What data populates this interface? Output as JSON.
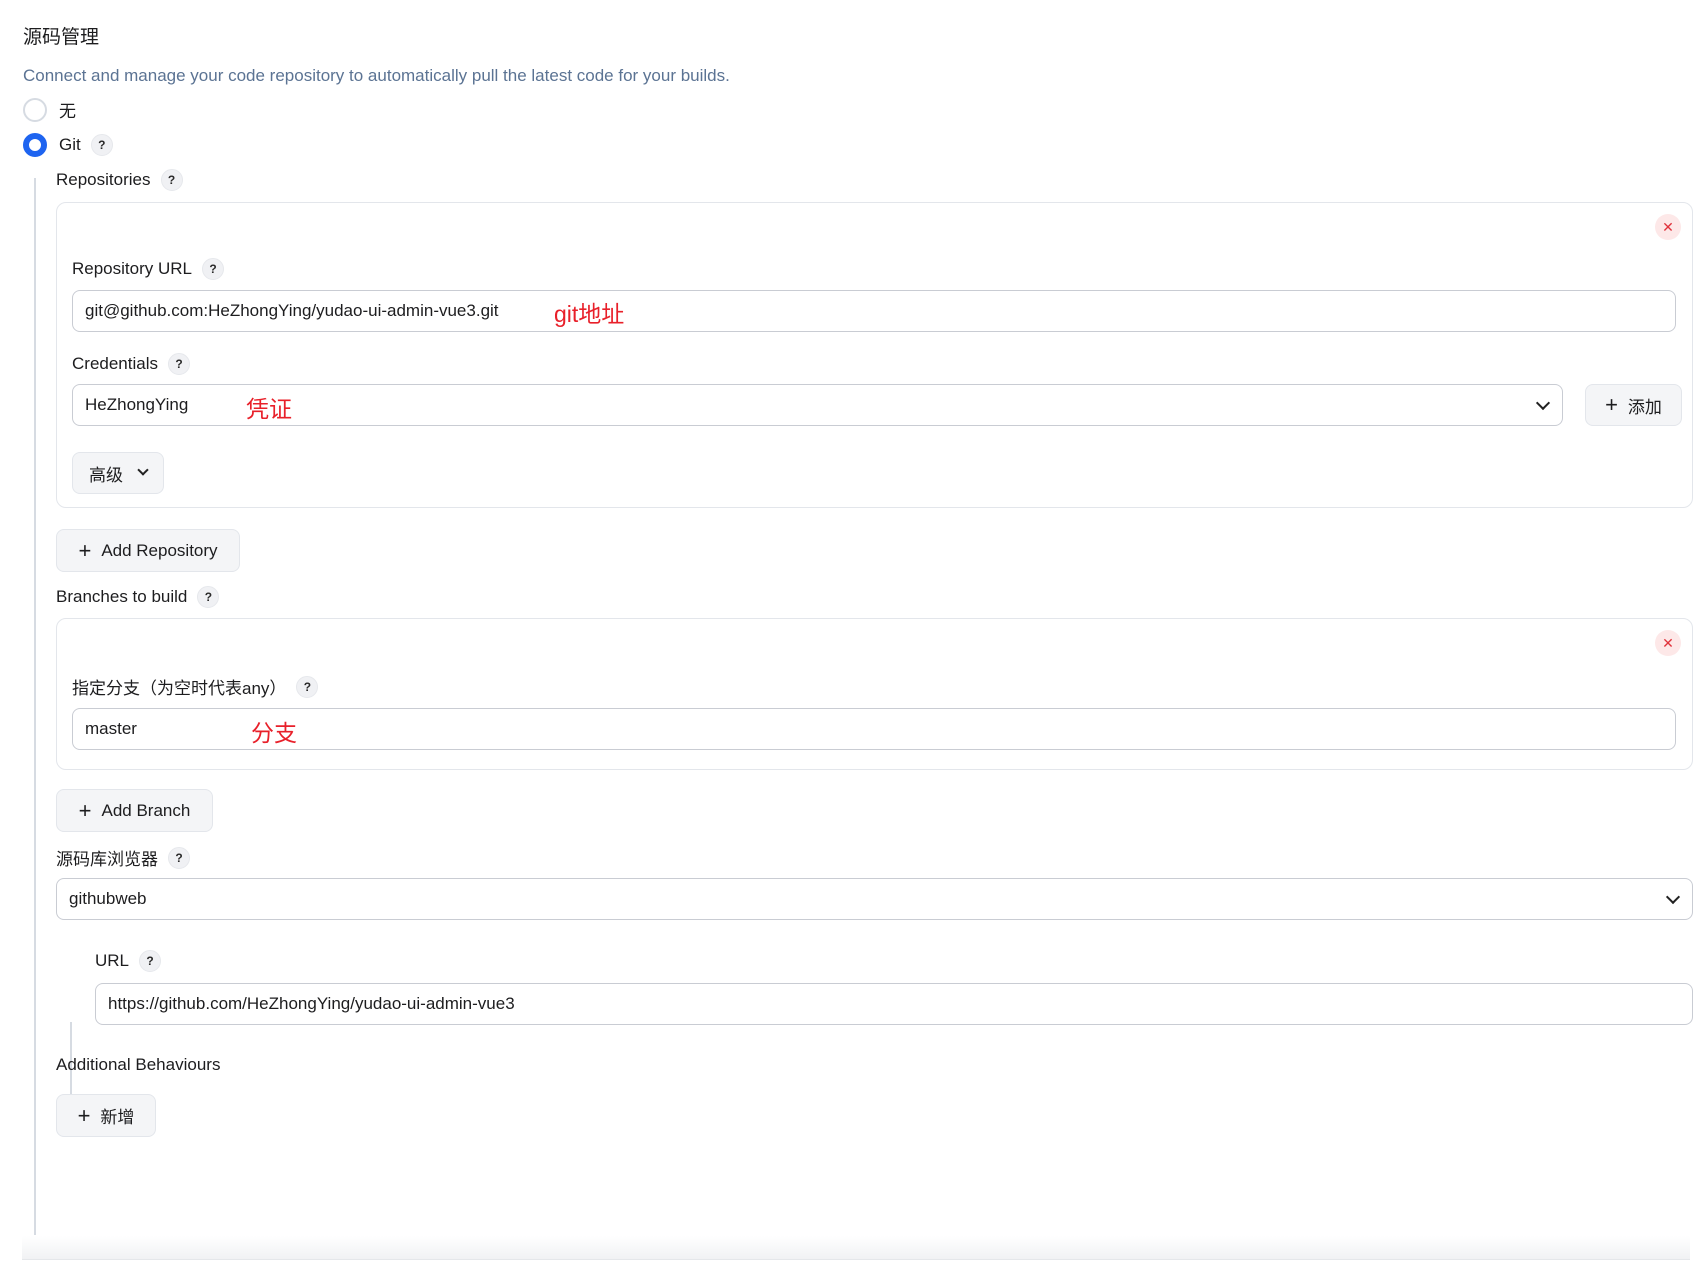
{
  "section": {
    "title": "源码管理",
    "description": "Connect and manage your code repository to automatically pull the latest code for your builds."
  },
  "scm_options": [
    {
      "label": "无",
      "selected": false
    },
    {
      "label": "Git",
      "selected": true
    }
  ],
  "help_glyph": "?",
  "close_glyph": "✕",
  "plus_glyph": "+",
  "repositories": {
    "label": "Repositories",
    "items": [
      {
        "url_label": "Repository URL",
        "url_value": "git@github.com:HeZhongYing/yudao-ui-admin-vue3.git",
        "url_annotation": "git地址",
        "credentials_label": "Credentials",
        "credentials_value": "HeZhongYing",
        "credentials_annotation": "凭证",
        "add_credentials_label": "添加",
        "advanced_label": "高级"
      }
    ],
    "add_button_label": "Add Repository"
  },
  "branches": {
    "label": "Branches to build",
    "items": [
      {
        "spec_label": "指定分支（为空时代表any）",
        "spec_value": "master",
        "spec_annotation": "分支"
      }
    ],
    "add_button_label": "Add Branch"
  },
  "repo_browser": {
    "label": "源码库浏览器",
    "selected": "githubweb",
    "url_label": "URL",
    "url_value": "https://github.com/HeZhongYing/yudao-ui-admin-vue3"
  },
  "additional_behaviours": {
    "label": "Additional Behaviours",
    "add_button_label": "新增"
  },
  "colors": {
    "accent": "#1e64f0",
    "annotation": "#e8202a",
    "description": "#5b7393",
    "danger": "#e0323b"
  }
}
